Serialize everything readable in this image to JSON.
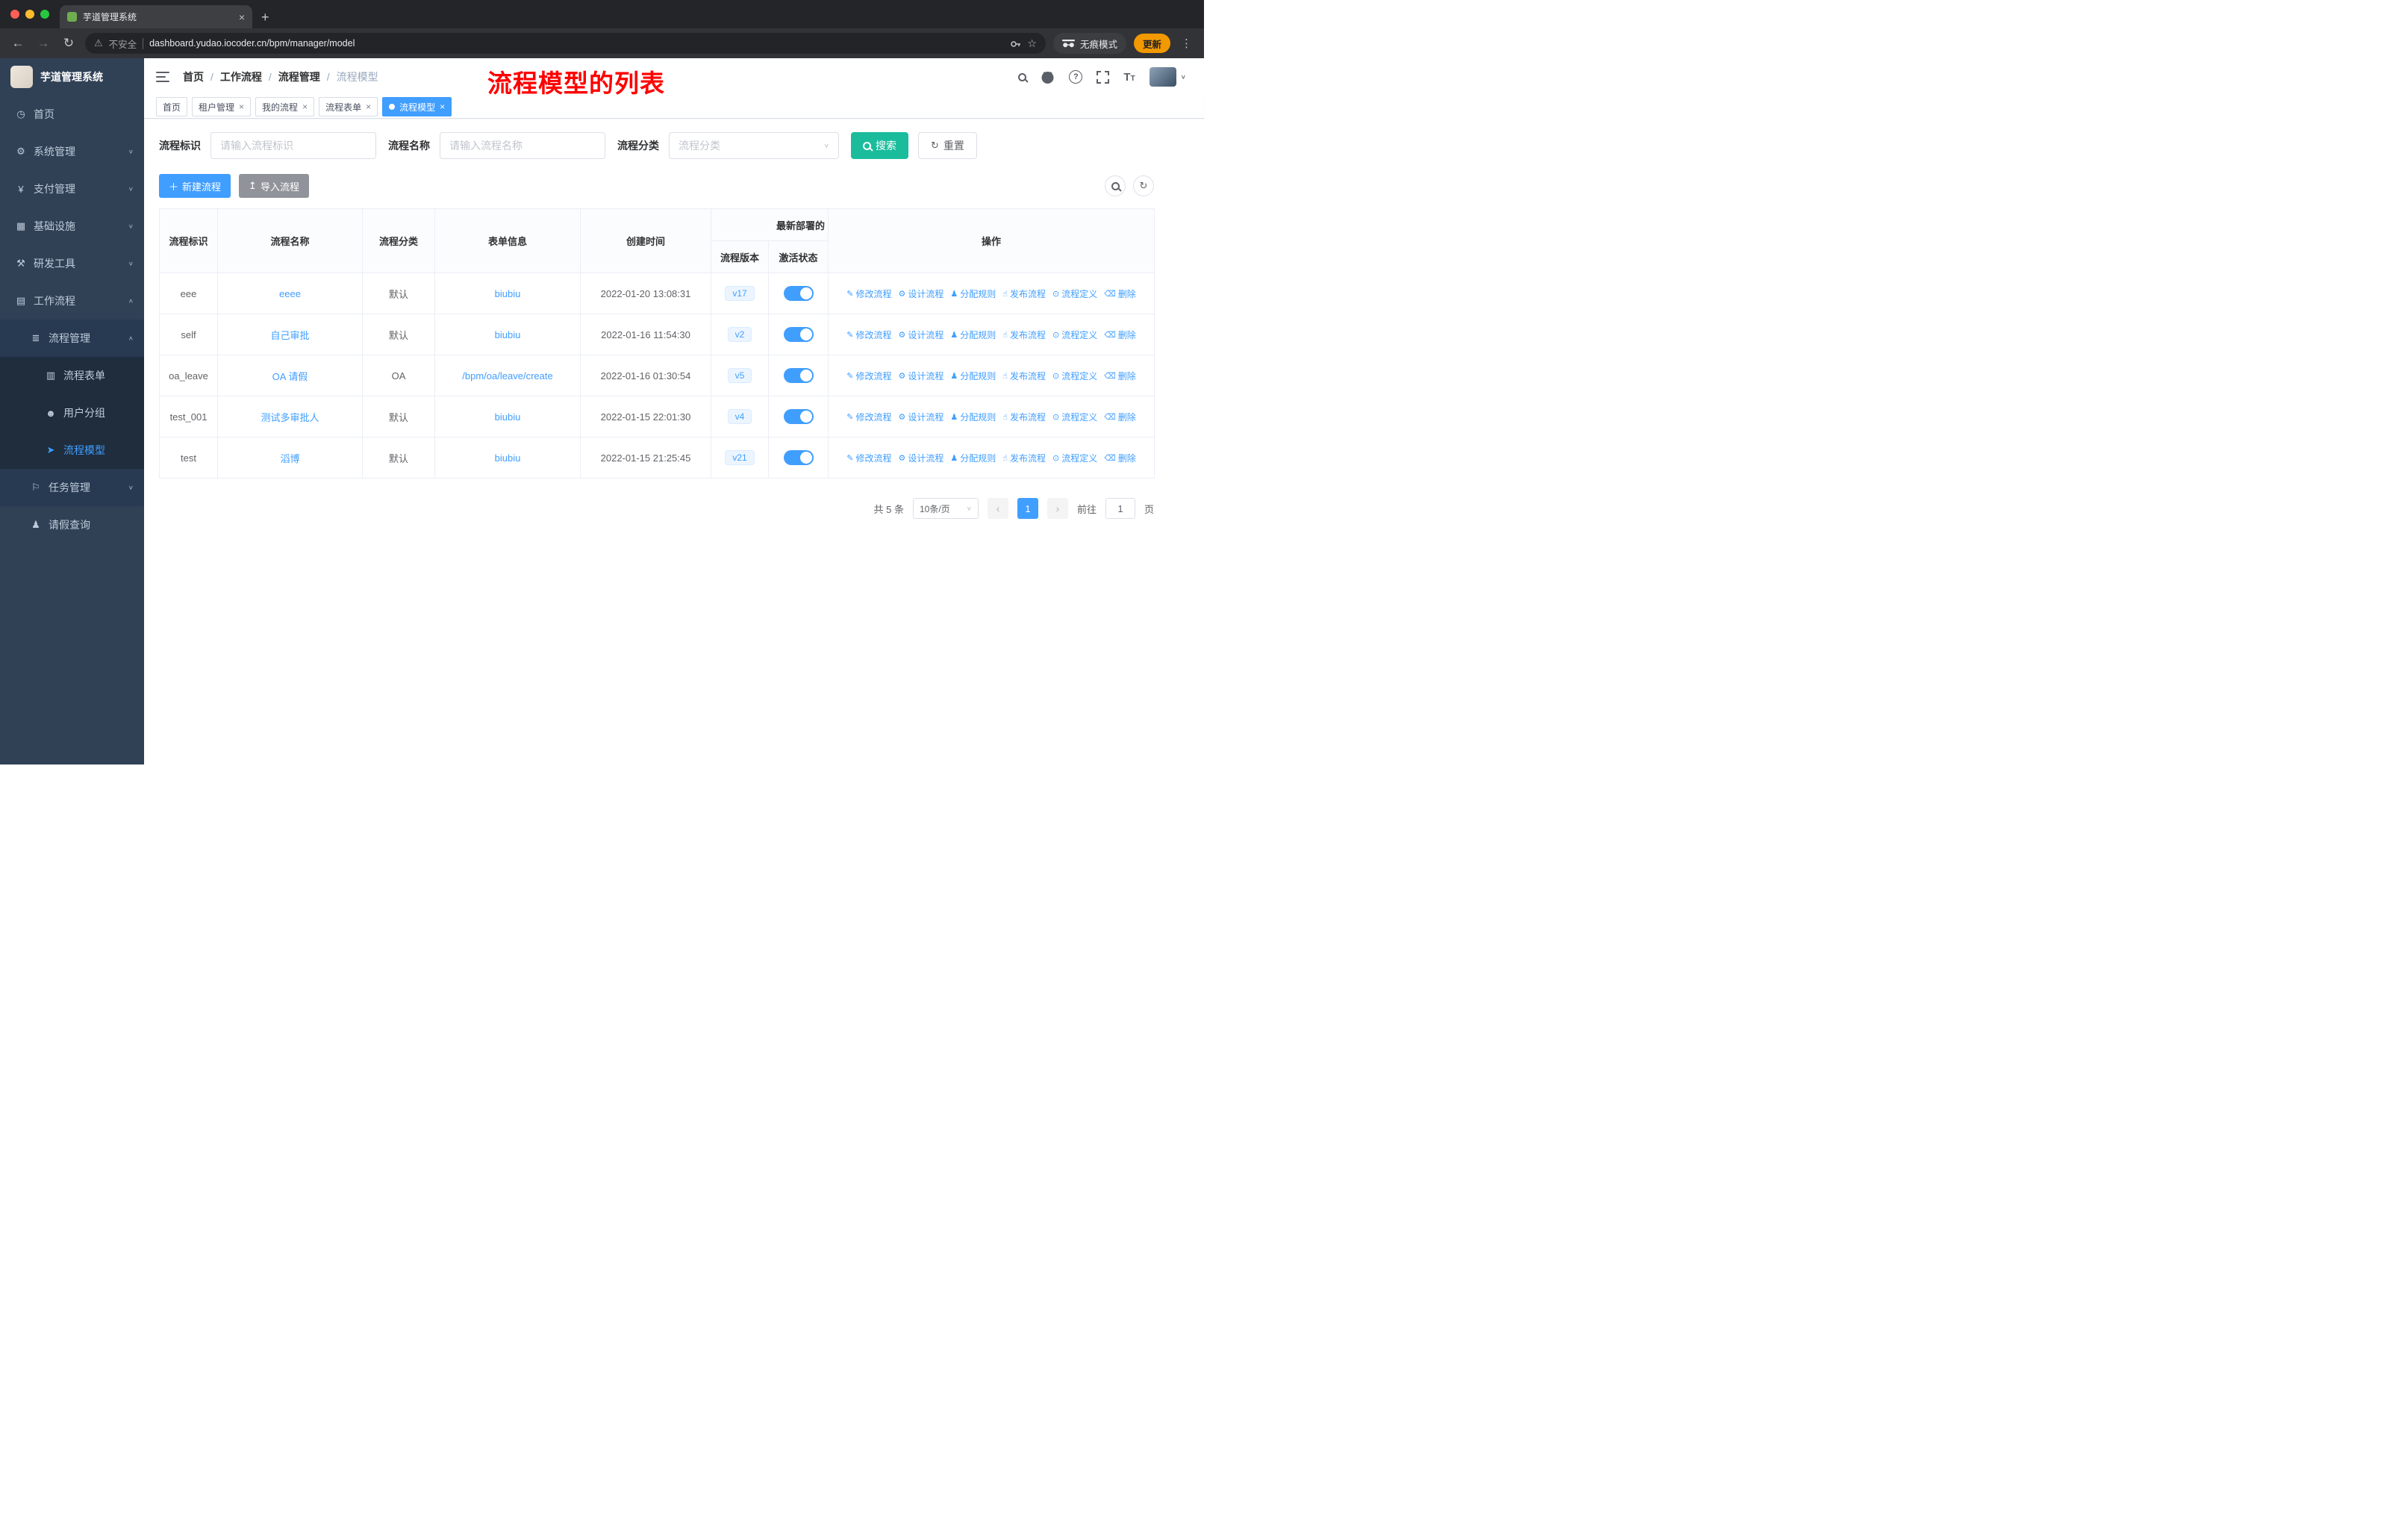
{
  "colors": {
    "accent": "#409EFF",
    "search_button": "#1ABC9C",
    "annotation_red": "#FF0000",
    "update_chip": "#F29900",
    "sidebar_bg": "#304156"
  },
  "browser": {
    "tab_title": "芋道管理系统",
    "security_label": "不安全",
    "url": "dashboard.yudao.iocoder.cn/bpm/manager/model",
    "incognito_label": "无痕模式",
    "update_label": "更新"
  },
  "sidebar": {
    "title": "芋道管理系统",
    "items": [
      {
        "icon": "dashboard-icon",
        "label": "首页",
        "level": 1
      },
      {
        "icon": "gear-icon",
        "label": "系统管理",
        "level": 1,
        "arrow": "down"
      },
      {
        "icon": "payment-icon",
        "label": "支付管理",
        "level": 1,
        "arrow": "down"
      },
      {
        "icon": "infrastructure-icon",
        "label": "基础设施",
        "level": 1,
        "arrow": "down"
      },
      {
        "icon": "devtools-icon",
        "label": "研发工具",
        "level": 1,
        "arrow": "down"
      },
      {
        "icon": "workflow-icon",
        "label": "工作流程",
        "level": 1,
        "arrow": "up"
      },
      {
        "icon": "process-manage-icon",
        "label": "流程管理",
        "level": 2,
        "arrow": "up"
      },
      {
        "icon": "process-form-icon",
        "label": "流程表单",
        "level": 3
      },
      {
        "icon": "user-group-icon",
        "label": "用户分组",
        "level": 3
      },
      {
        "icon": "process-model-icon",
        "label": "流程模型",
        "level": 3,
        "active": true
      },
      {
        "icon": "task-manage-icon",
        "label": "任务管理",
        "level": 2,
        "arrow": "down"
      },
      {
        "icon": "leave-query-icon",
        "label": "请假查询",
        "level": 2,
        "nobg": true
      }
    ]
  },
  "header": {
    "breadcrumb": [
      "首页",
      "工作流程",
      "流程管理",
      "流程模型"
    ],
    "annotation": "流程模型的列表"
  },
  "tags": [
    {
      "label": "首页",
      "closable": false,
      "active": false
    },
    {
      "label": "租户管理",
      "closable": true,
      "active": false
    },
    {
      "label": "我的流程",
      "closable": true,
      "active": false
    },
    {
      "label": "流程表单",
      "closable": true,
      "active": false
    },
    {
      "label": "流程模型",
      "closable": true,
      "active": true
    }
  ],
  "filters": {
    "id_label": "流程标识",
    "id_placeholder": "请输入流程标识",
    "name_label": "流程名称",
    "name_placeholder": "请输入流程名称",
    "category_label": "流程分类",
    "category_placeholder": "流程分类",
    "search_label": "搜索",
    "reset_label": "重置"
  },
  "toolbar": {
    "create_label": "新建流程",
    "import_label": "导入流程"
  },
  "table": {
    "headers": {
      "id": "流程标识",
      "name": "流程名称",
      "category": "流程分类",
      "form": "表单信息",
      "created": "创建时间",
      "deploy_group": "最新部署的",
      "version": "流程版本",
      "status": "激活状态",
      "actions": "操作"
    },
    "rows": [
      {
        "id": "eee",
        "name": "eeee",
        "category": "默认",
        "form": "biubiu",
        "created": "2022-01-20 13:08:31",
        "version": "v17",
        "active": true
      },
      {
        "id": "self",
        "name": "自己审批",
        "category": "默认",
        "form": "biubiu",
        "created": "2022-01-16 11:54:30",
        "version": "v2",
        "active": true
      },
      {
        "id": "oa_leave",
        "name": "OA 请假",
        "category": "OA",
        "form": "/bpm/oa/leave/create",
        "created": "2022-01-16 01:30:54",
        "version": "v5",
        "active": true
      },
      {
        "id": "test_001",
        "name": "测试多审批人",
        "category": "默认",
        "form": "biubiu",
        "created": "2022-01-15 22:01:30",
        "version": "v4",
        "active": true
      },
      {
        "id": "test",
        "name": "滔博",
        "category": "默认",
        "form": "biubiu",
        "created": "2022-01-15 21:25:45",
        "version": "v21",
        "active": true
      }
    ],
    "actions": [
      {
        "label": "修改流程",
        "icon": "edit-icon"
      },
      {
        "label": "设计流程",
        "icon": "design-icon"
      },
      {
        "label": "分配规则",
        "icon": "assign-rule-icon"
      },
      {
        "label": "发布流程",
        "icon": "publish-icon"
      },
      {
        "label": "流程定义",
        "icon": "definition-icon"
      },
      {
        "label": "删除",
        "icon": "delete-icon"
      }
    ]
  },
  "pagination": {
    "total": "共 5 条",
    "page_size": "10条/页",
    "page": "1",
    "goto_label": "前往",
    "goto_value": "1",
    "unit": "页"
  }
}
